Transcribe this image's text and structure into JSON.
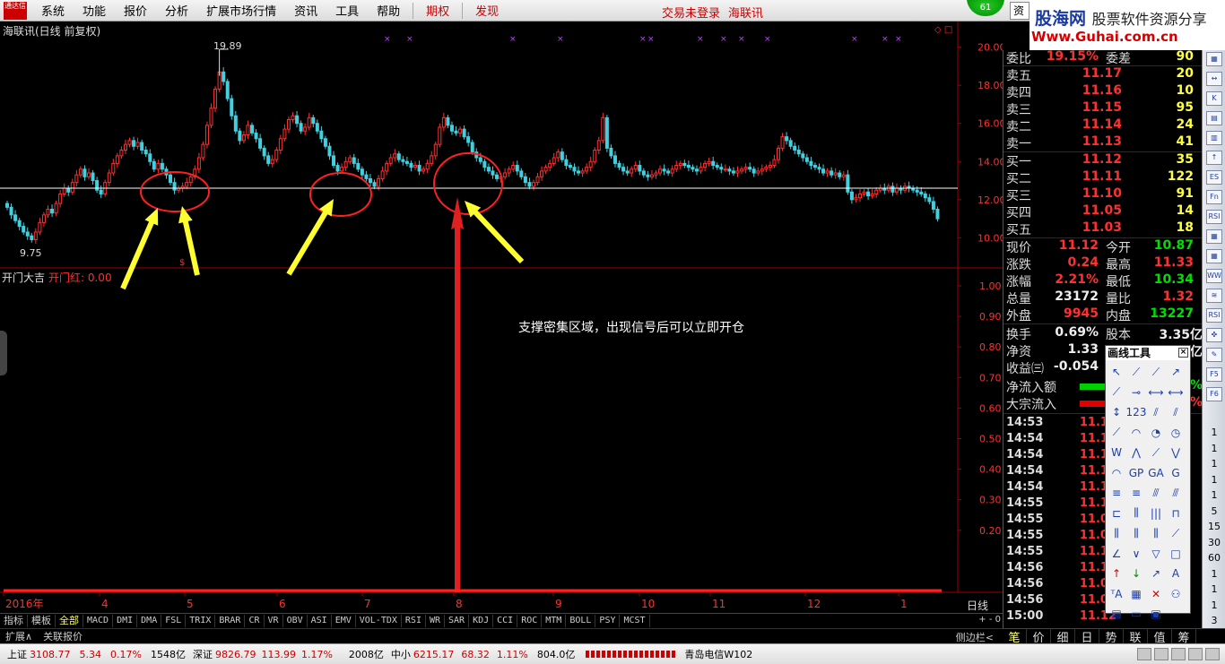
{
  "menu": {
    "items": [
      "系统",
      "功能",
      "报价",
      "分析",
      "扩展市场行情",
      "资讯",
      "工具",
      "帮助"
    ],
    "red_items": [
      "期权",
      "发现"
    ],
    "login_status": "交易未登录",
    "broker_name": "海联讯",
    "badge_count": "61",
    "search_stub": "资"
  },
  "watermark": {
    "site_cn": "股海网",
    "slogan": "股票软件资源分享",
    "url": "Www.Guhai.com.cn"
  },
  "chart": {
    "title": "海联讯(日线 前复权)",
    "high_tag": "19.89",
    "low_tag": "9.75",
    "price_axis": [
      "20.00",
      "18.00",
      "16.00",
      "14.00",
      "12.00",
      "10.00"
    ],
    "indicator_name": "开门大吉",
    "indicator_value": "开门红: 0.00",
    "indicator_axis": [
      "1.00",
      "0.90",
      "0.80",
      "0.70",
      "0.60",
      "0.50",
      "0.40",
      "0.30",
      "0.20"
    ],
    "annotation": "支撑密集区域，出现信号后可以立即开仓",
    "month_labels": [
      "2016年",
      "4",
      "5",
      "6",
      "7",
      "8",
      "9",
      "10",
      "11",
      "12",
      "1"
    ],
    "period": "日线",
    "colors": {
      "up": "#ff3030",
      "down": "#40d0e0",
      "support": "#ffffff",
      "arrow": "#ffff30",
      "circle": "#ff2020"
    }
  },
  "chart_data": {
    "type": "candlestick",
    "ylim": [
      9.5,
      20.5
    ],
    "support_level": 12.6,
    "signal_index": 128,
    "closes": [
      11.6,
      11.2,
      10.9,
      10.6,
      10.3,
      10.1,
      9.9,
      10.3,
      10.8,
      11.2,
      11.5,
      11.3,
      11.8,
      12.3,
      12.6,
      12.4,
      12.9,
      13.3,
      13.6,
      13.2,
      13.4,
      13.0,
      12.5,
      12.3,
      12.9,
      13.4,
      13.9,
      14.3,
      14.6,
      14.9,
      15.1,
      14.8,
      15.0,
      14.6,
      14.4,
      14.0,
      13.6,
      13.9,
      13.6,
      13.3,
      12.9,
      12.5,
      12.6,
      12.7,
      12.9,
      13.2,
      13.6,
      14.2,
      14.9,
      15.9,
      16.8,
      17.8,
      18.7,
      18.2,
      17.3,
      16.4,
      15.6,
      15.1,
      15.4,
      15.9,
      15.5,
      15.2,
      14.7,
      14.3,
      13.9,
      14.1,
      14.6,
      15.2,
      15.7,
      16.2,
      16.4,
      16.0,
      15.6,
      15.8,
      16.3,
      16.0,
      15.6,
      15.2,
      14.8,
      14.3,
      13.8,
      13.5,
      13.7,
      14.0,
      14.2,
      13.9,
      13.6,
      13.3,
      13.1,
      12.9,
      12.7,
      13.1,
      13.5,
      13.9,
      14.2,
      14.4,
      14.1,
      14.0,
      13.9,
      13.7,
      13.8,
      13.5,
      13.6,
      13.9,
      14.3,
      14.9,
      15.8,
      16.3,
      15.9,
      15.6,
      15.5,
      15.7,
      15.3,
      15.0,
      14.5,
      14.2,
      14.0,
      13.7,
      13.5,
      13.3,
      13.1,
      13.2,
      13.4,
      13.6,
      13.8,
      13.5,
      13.2,
      12.9,
      12.7,
      12.9,
      13.2,
      13.5,
      13.7,
      13.9,
      14.2,
      14.5,
      14.1,
      13.8,
      13.7,
      13.5,
      13.4,
      13.5,
      13.7,
      14.0,
      14.6,
      15.1,
      16.3,
      14.7,
      14.3,
      13.9,
      13.7,
      13.5,
      13.4,
      13.6,
      13.8,
      13.5,
      13.3,
      13.2,
      13.3,
      13.4,
      13.6,
      13.5,
      13.4,
      13.6,
      13.8,
      13.9,
      13.8,
      13.7,
      13.6,
      13.5,
      13.7,
      13.9,
      14.0,
      13.8,
      13.7,
      13.6,
      13.6,
      13.5,
      13.4,
      13.5,
      13.6,
      13.7,
      13.6,
      13.4,
      13.5,
      13.6,
      13.7,
      13.8,
      14.1,
      14.7,
      15.3,
      15.1,
      14.8,
      14.6,
      14.4,
      14.2,
      14.0,
      13.8,
      13.7,
      13.6,
      13.4,
      13.5,
      13.3,
      13.4,
      13.2,
      13.3,
      12.4,
      12.0,
      12.1,
      12.3,
      12.4,
      12.2,
      12.3,
      12.5,
      12.6,
      12.5,
      12.7,
      12.4,
      12.6,
      12.5,
      12.7,
      12.6,
      12.5,
      12.4,
      12.3,
      12.1,
      11.9,
      11.5,
      11.0
    ]
  },
  "indicator_tabs": [
    "指标",
    "模板",
    "全部",
    "MACD",
    "DMI",
    "DMA",
    "FSL",
    "TRIX",
    "BRAR",
    "CR",
    "VR",
    "OBV",
    "ASI",
    "EMV",
    "VOL-TDX",
    "RSI",
    "WR",
    "SAR",
    "KDJ",
    "CCI",
    "ROC",
    "MTM",
    "BOLL",
    "PSY",
    "MCST"
  ],
  "tab_controls": "+ - 0",
  "strip": {
    "expand": "扩展∧",
    "related": "关联报价",
    "sidebar": "侧边栏<"
  },
  "statusbar": {
    "sh_label": "上证",
    "sh_index": "3108.77",
    "sh_change": "5.34",
    "sh_pct": "0.17%",
    "sh_amount": "1548亿",
    "sz_label": "深证",
    "sz_index": "9826.79",
    "sz_change": "113.99",
    "sz_pct": "1.17%",
    "sz_amount": "2008亿",
    "zx_label": "中小",
    "zx_index": "6215.17",
    "zx_change": "68.32",
    "zx_pct": "1.11%",
    "zx_amount": "804.0亿",
    "server": "青岛电信W102"
  },
  "quote": {
    "weibi": {
      "k": "委比",
      "v": "19.15%",
      "k2": "委差",
      "v2": "90"
    },
    "sell": [
      {
        "k": "卖五",
        "p": "11.17",
        "q": "20"
      },
      {
        "k": "卖四",
        "p": "11.16",
        "q": "10"
      },
      {
        "k": "卖三",
        "p": "11.15",
        "q": "95"
      },
      {
        "k": "卖二",
        "p": "11.14",
        "q": "24"
      },
      {
        "k": "卖一",
        "p": "11.13",
        "q": "41"
      }
    ],
    "buy": [
      {
        "k": "买一",
        "p": "11.12",
        "q": "35"
      },
      {
        "k": "买二",
        "p": "11.11",
        "q": "122"
      },
      {
        "k": "买三",
        "p": "11.10",
        "q": "91"
      },
      {
        "k": "买四",
        "p": "11.05",
        "q": "14"
      },
      {
        "k": "买五",
        "p": "11.03",
        "q": "18"
      }
    ],
    "stats": [
      {
        "k": "现价",
        "v": "11.12",
        "vc": "red",
        "k2": "今开",
        "v2": "10.87",
        "v2c": "green"
      },
      {
        "k": "涨跌",
        "v": "0.24",
        "vc": "red",
        "k2": "最高",
        "v2": "11.33",
        "v2c": "red"
      },
      {
        "k": "涨幅",
        "v": "2.21%",
        "vc": "red",
        "k2": "最低",
        "v2": "10.34",
        "v2c": "green"
      },
      {
        "k": "总量",
        "v": "23172",
        "vc": "white",
        "k2": "量比",
        "v2": "1.32",
        "v2c": "red"
      },
      {
        "k": "外盘",
        "v": "9945",
        "vc": "red",
        "k2": "内盘",
        "v2": "13227",
        "v2c": "green"
      }
    ],
    "finance": [
      {
        "k": "换手",
        "v": "0.69%",
        "k2": "股本",
        "v2": "3.35亿"
      },
      {
        "k": "净资",
        "v": "1.33",
        "k2": "",
        "v2": "亿"
      },
      {
        "k": "收益㈢",
        "v": "-0.054",
        "k2": "",
        "v2": ""
      }
    ],
    "flow": [
      {
        "k": "净流入额",
        "suffix": "%"
      },
      {
        "k": "大宗流入",
        "suffix": "%"
      }
    ],
    "ticks": [
      {
        "t": "14:53",
        "p": "11.14"
      },
      {
        "t": "14:54",
        "p": "11.14"
      },
      {
        "t": "14:54",
        "p": "11.14"
      },
      {
        "t": "14:54",
        "p": "11.15"
      },
      {
        "t": "14:54",
        "p": "11.15"
      },
      {
        "t": "14:55",
        "p": "11.15"
      },
      {
        "t": "14:55",
        "p": "11.08"
      },
      {
        "t": "14:55",
        "p": "11.02"
      },
      {
        "t": "14:55",
        "p": "11.15"
      },
      {
        "t": "14:56",
        "p": "11.15"
      },
      {
        "t": "14:56",
        "p": "11.07"
      },
      {
        "t": "14:56",
        "p": "11.02"
      },
      {
        "t": "15:00",
        "p": "11.12"
      }
    ]
  },
  "draw_tools": {
    "title": "画线工具",
    "close": "×",
    "icons": [
      "↖",
      "⟋",
      "⟋",
      "↗",
      "⟋",
      "⊸",
      "⟷",
      "⟷",
      "↕",
      "123",
      "⫽",
      "⫽",
      "⟋",
      "◠",
      "◔",
      "◷",
      "W",
      "⋀",
      "⟋",
      "⋁",
      "◠",
      "GP",
      "GA",
      "G",
      "≡",
      "≡",
      "⫻",
      "⫻",
      "⊏",
      "⫼",
      "|||",
      "⊓",
      "⫼",
      "⫼",
      "⫼",
      "⟋",
      "∠",
      "∨",
      "▽",
      "□",
      "↑",
      "↓",
      "↗",
      "A",
      "ᵀA",
      "▦",
      "✕",
      "⚇",
      "▤",
      "▭",
      "▣",
      ""
    ]
  },
  "right_icons": {
    "labels": [
      "▦",
      "↔",
      "K",
      "▤",
      "▥",
      "↑",
      "ES",
      "Fn",
      "RSI",
      "▦",
      "▦",
      "WW",
      "≋",
      "RSI",
      "✜",
      "✎",
      "F5",
      "F6"
    ],
    "nums": [
      "1",
      "1",
      "1",
      "1",
      "1",
      "5",
      "15",
      "30",
      "60",
      "1",
      "1",
      "1",
      "3"
    ]
  },
  "mini_tabs": [
    "笔",
    "价",
    "细",
    "日",
    "势",
    "联",
    "值",
    "筹"
  ]
}
